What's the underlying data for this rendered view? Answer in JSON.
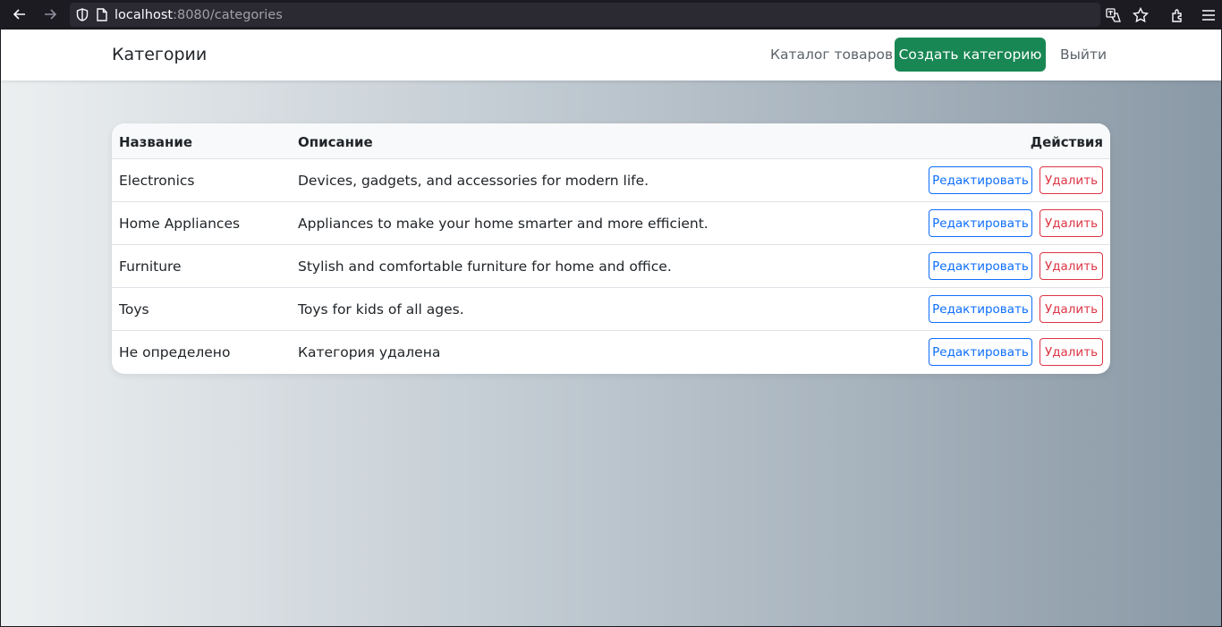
{
  "browser": {
    "url_host": "localhost",
    "url_rest": ":8080/categories"
  },
  "navbar": {
    "brand": "Категории",
    "catalog_link": "Каталог товаров",
    "create_button": "Создать категорию",
    "logout_link": "Выйти"
  },
  "table": {
    "headers": {
      "name": "Название",
      "description": "Описание",
      "actions": "Действия"
    },
    "edit_label": "Редактировать",
    "delete_label": "Удалить",
    "rows": [
      {
        "name": "Electronics",
        "description": "Devices, gadgets, and accessories for modern life."
      },
      {
        "name": "Home Appliances",
        "description": "Appliances to make your home smarter and more efficient."
      },
      {
        "name": "Furniture",
        "description": "Stylish and comfortable furniture for home and office."
      },
      {
        "name": "Toys",
        "description": "Toys for kids of all ages."
      },
      {
        "name": "Не определено",
        "description": "Категория удалена"
      }
    ]
  },
  "colors": {
    "primary": "#0d6efd",
    "success": "#198754",
    "danger": "#dc3545"
  }
}
